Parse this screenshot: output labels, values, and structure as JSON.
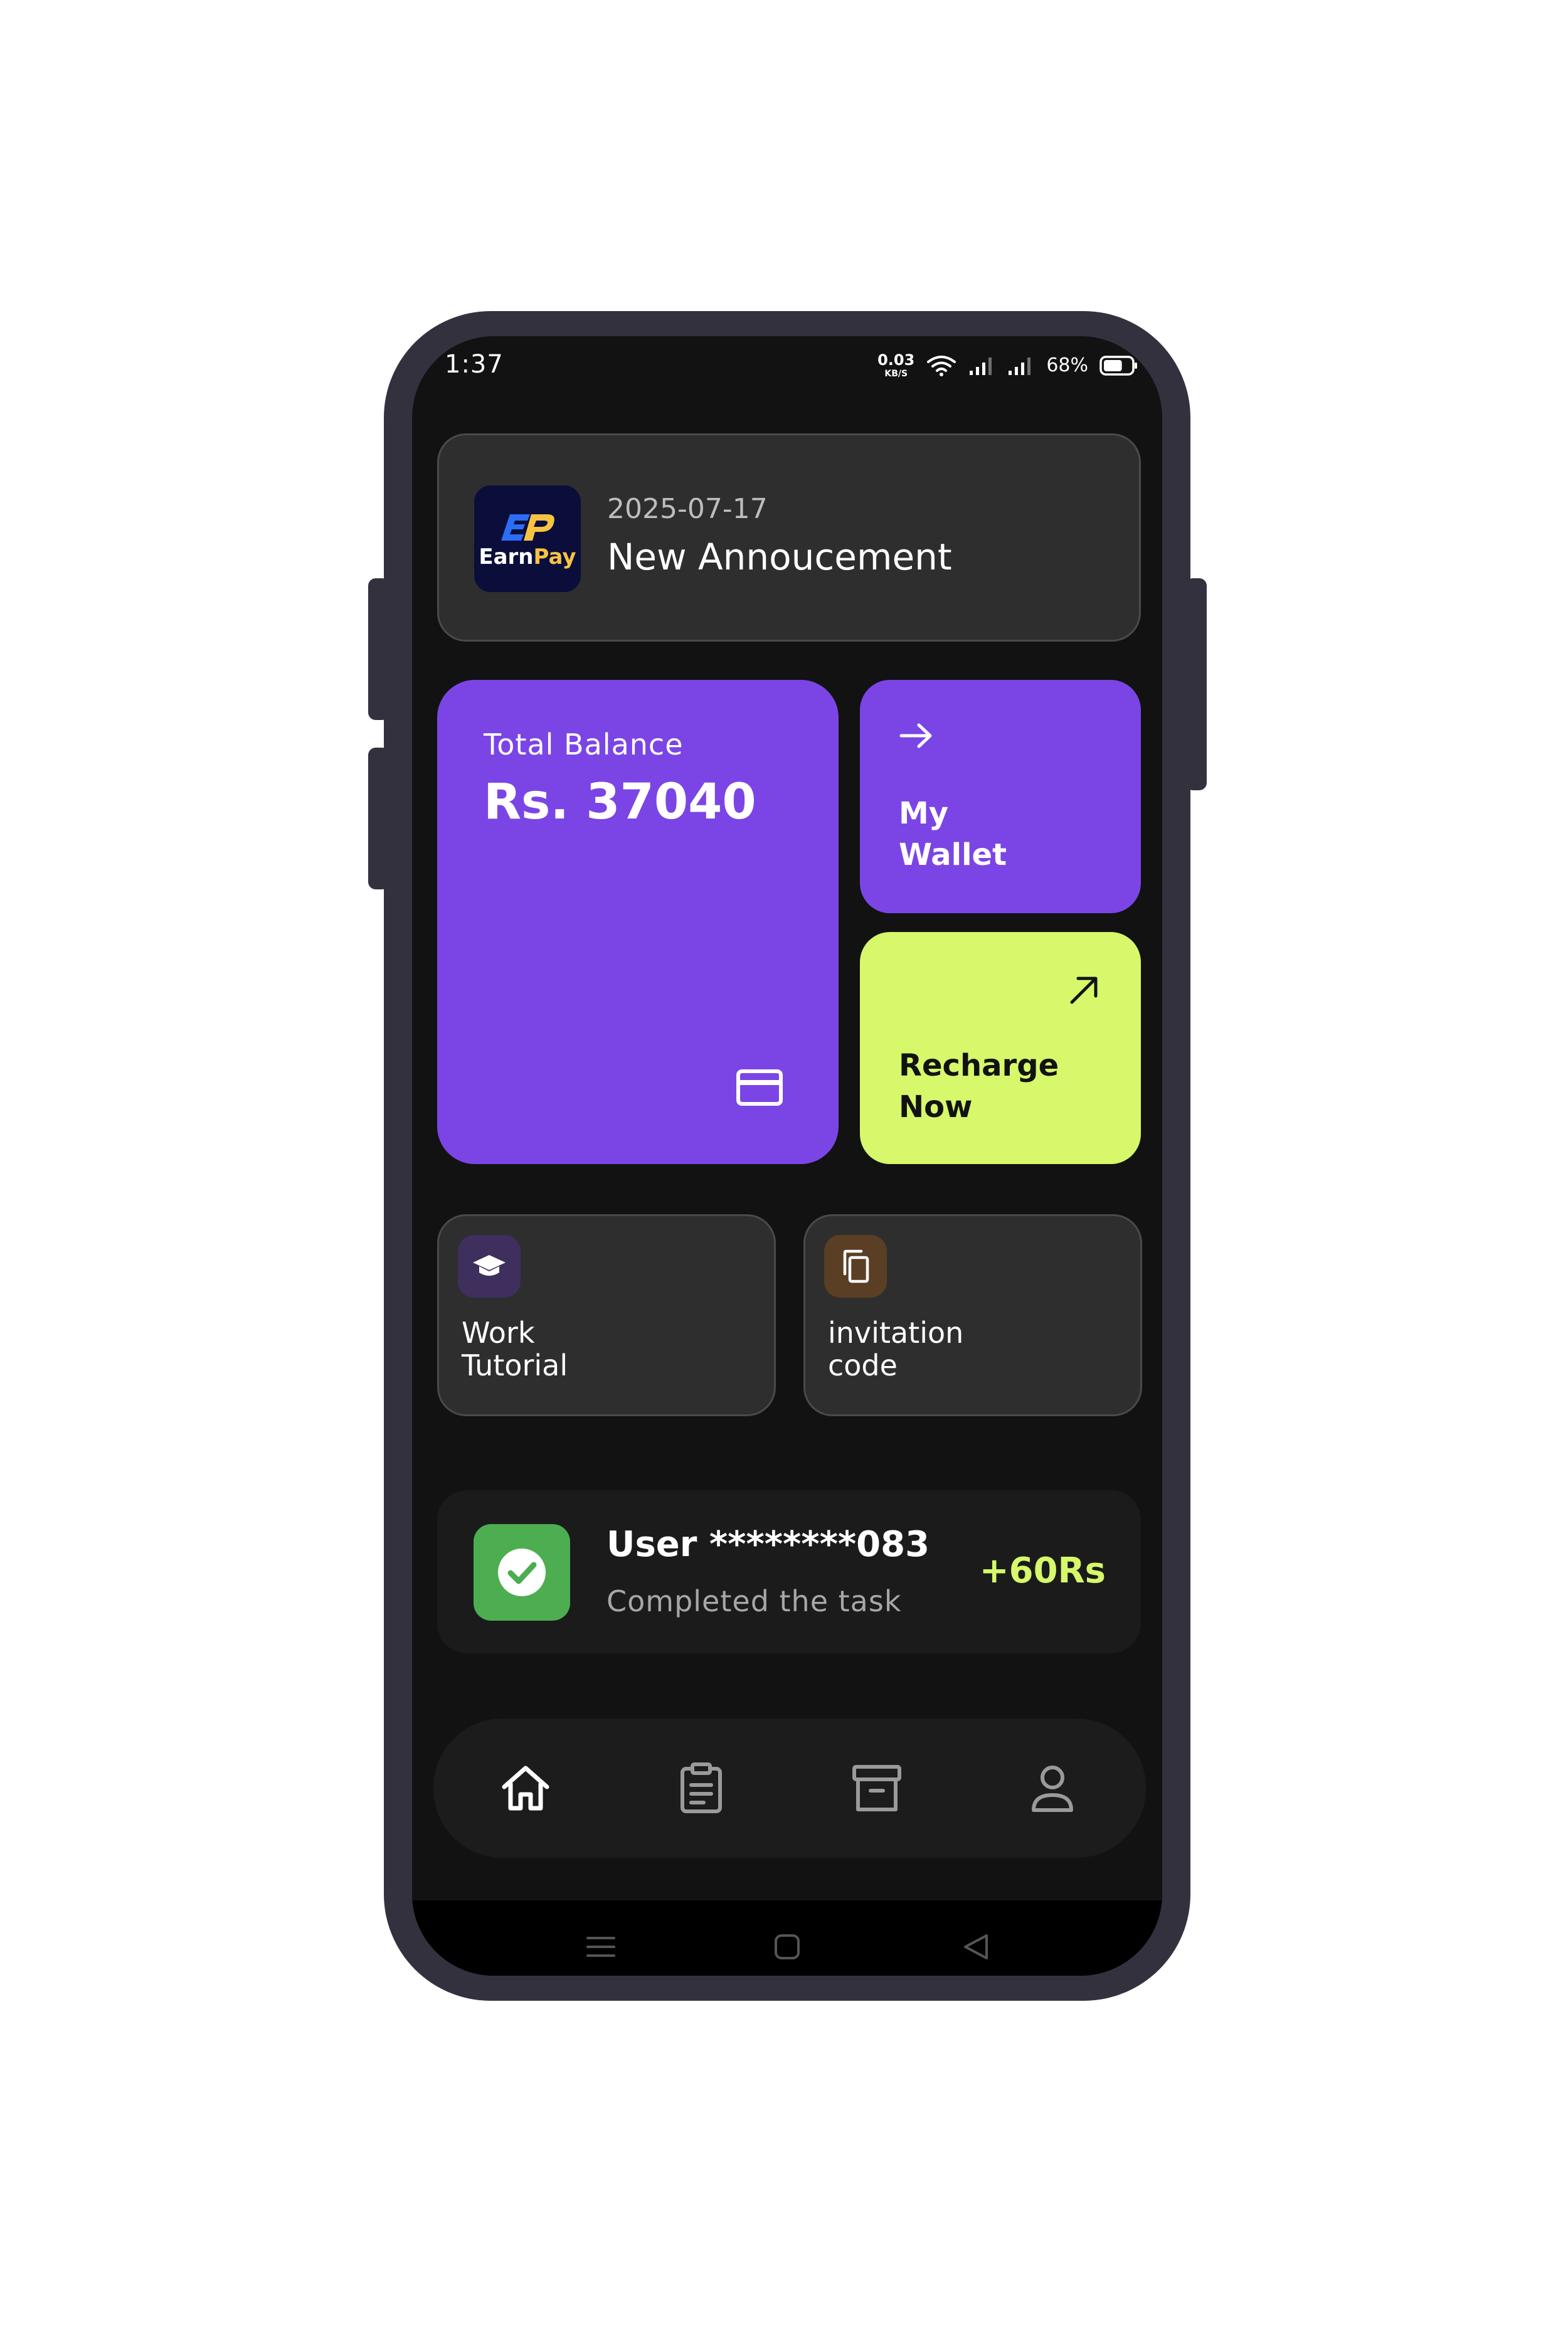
{
  "status_bar": {
    "time": "1:37",
    "net_speed_value": "0.03",
    "net_speed_unit": "KB/S",
    "battery_text": "68%",
    "battery_level": 0.68
  },
  "announcement": {
    "logo_text_main": "Earn",
    "logo_text_accent": "Pay",
    "logo_mark": "EP",
    "date": "2025-07-17",
    "title": "New Annoucement"
  },
  "balance": {
    "label": "Total Balance",
    "amount": "Rs. 37040"
  },
  "wallet": {
    "line1": "My",
    "line2": "Wallet"
  },
  "recharge": {
    "line1": "Recharge",
    "line2": "Now"
  },
  "quick_cards": {
    "tutorial": {
      "line1": "Work",
      "line2": "Tutorial"
    },
    "invitation": {
      "line1": "invitation",
      "line2": "code"
    }
  },
  "task": {
    "user": "User ********083",
    "description": "Completed the task",
    "amount": "+60Rs"
  },
  "bottom_nav": {
    "items": [
      {
        "icon": "home-icon",
        "active": true
      },
      {
        "icon": "clipboard-icon",
        "active": false
      },
      {
        "icon": "archive-icon",
        "active": false
      },
      {
        "icon": "user-icon",
        "active": false
      }
    ]
  },
  "colors": {
    "primary_purple": "#7b45e6",
    "accent_lime": "#d6f86a",
    "success_green": "#4cae50",
    "frame": "#34313f",
    "background": "#121212"
  }
}
